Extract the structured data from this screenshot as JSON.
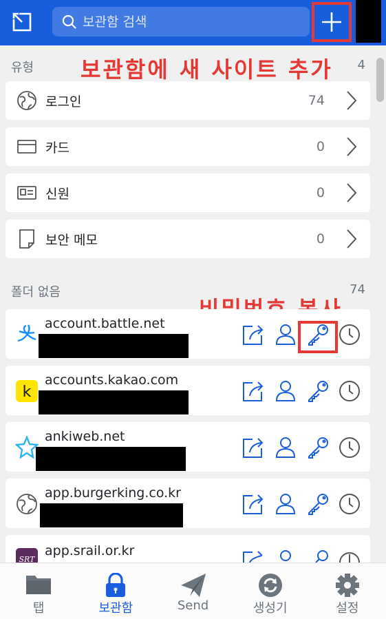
{
  "header": {
    "search_placeholder": "보관함 검색",
    "add_label": "+"
  },
  "annotations": {
    "add_site": "보관함에 새 사이트 추가",
    "copy_password": "비밀번호 복사"
  },
  "types": {
    "heading": "유형",
    "count": "4",
    "items": [
      {
        "label": "로그인",
        "count": "74",
        "icon": "globe-icon"
      },
      {
        "label": "카드",
        "count": "0",
        "icon": "card-icon"
      },
      {
        "label": "신원",
        "count": "0",
        "icon": "id-card-icon"
      },
      {
        "label": "보안 메모",
        "count": "0",
        "icon": "note-icon"
      }
    ]
  },
  "folders": {
    "heading": "폴더 없음",
    "count": "74",
    "items": [
      {
        "name": "account.battle.net",
        "icon": "battlenet-icon"
      },
      {
        "name": "accounts.kakao.com",
        "icon": "kakao-icon"
      },
      {
        "name": "ankiweb.net",
        "icon": "anki-star-icon"
      },
      {
        "name": "app.burgerking.co.kr",
        "icon": "globe-icon"
      },
      {
        "name": "app.srail.or.kr",
        "icon": "srt-icon"
      }
    ]
  },
  "nav": {
    "tabs": [
      {
        "label": "탭",
        "icon": "folder-icon"
      },
      {
        "label": "보관함",
        "icon": "lock-icon"
      },
      {
        "label": "Send",
        "icon": "paper-plane-icon"
      },
      {
        "label": "생성기",
        "icon": "refresh-icon"
      },
      {
        "label": "설정",
        "icon": "gear-icon"
      }
    ],
    "active": "보관함"
  },
  "colors": {
    "brand": "#175ddc",
    "annotation": "#e53935",
    "kakao": "#fee500"
  }
}
